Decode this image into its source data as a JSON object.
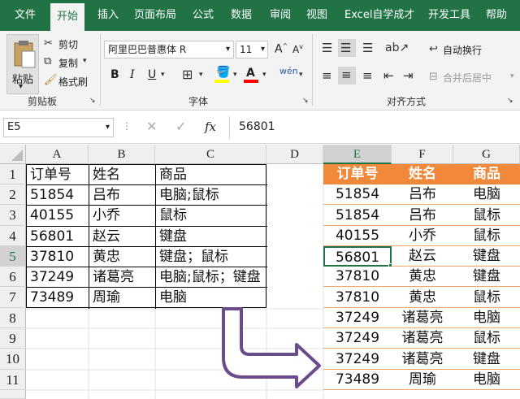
{
  "menu": {
    "items": [
      "文件",
      "开始",
      "插入",
      "页面布局",
      "公式",
      "数据",
      "审阅",
      "视图",
      "Excel自学成才",
      "开发工具",
      "帮助"
    ]
  },
  "ribbon": {
    "paste_label": "粘贴",
    "cut_label": "剪切",
    "copy_label": "复制",
    "format_painter_label": "格式刷",
    "clipboard_group": "剪贴板",
    "font_name": "阿里巴巴普惠体 R",
    "font_size": "11",
    "bold": "B",
    "italic": "I",
    "underline": "U",
    "font_group": "字体",
    "wrap_text_label": "自动换行",
    "merge_label": "合并后居中",
    "alignment_group": "对齐方式"
  },
  "formula_bar": {
    "name_box": "E5",
    "fx": "fx",
    "value": "56801"
  },
  "columns": [
    "A",
    "B",
    "C",
    "D",
    "E",
    "F",
    "G"
  ],
  "rows": [
    "1",
    "2",
    "3",
    "4",
    "5",
    "6",
    "7",
    "8",
    "9",
    "10",
    "11"
  ],
  "left_table": {
    "headers": [
      "订单号",
      "姓名",
      "商品"
    ],
    "rows": [
      [
        "51854",
        "吕布",
        "电脑;鼠标"
      ],
      [
        "40155",
        "小乔",
        "鼠标"
      ],
      [
        "56801",
        "赵云",
        "键盘"
      ],
      [
        "37810",
        "黄忠",
        "键盘；鼠标"
      ],
      [
        "37249",
        "诸葛亮",
        "电脑;鼠标；键盘"
      ],
      [
        "73489",
        "周瑜",
        "电脑"
      ]
    ]
  },
  "right_table": {
    "headers": [
      "订单号",
      "姓名",
      "商品"
    ],
    "rows": [
      [
        "51854",
        "吕布",
        "电脑"
      ],
      [
        "51854",
        "吕布",
        "鼠标"
      ],
      [
        "40155",
        "小乔",
        "鼠标"
      ],
      [
        "56801",
        "赵云",
        "键盘"
      ],
      [
        "37810",
        "黄忠",
        "键盘"
      ],
      [
        "37810",
        "黄忠",
        "鼠标"
      ],
      [
        "37249",
        "诸葛亮",
        "电脑"
      ],
      [
        "37249",
        "诸葛亮",
        "鼠标"
      ],
      [
        "37249",
        "诸葛亮",
        "键盘"
      ],
      [
        "73489",
        "周瑜",
        "电脑"
      ]
    ]
  },
  "colors": {
    "excel_green": "#217346",
    "header_orange": "#f08a3a",
    "border_orange": "#f2a66a",
    "arrow_purple": "#6b4c8a"
  }
}
